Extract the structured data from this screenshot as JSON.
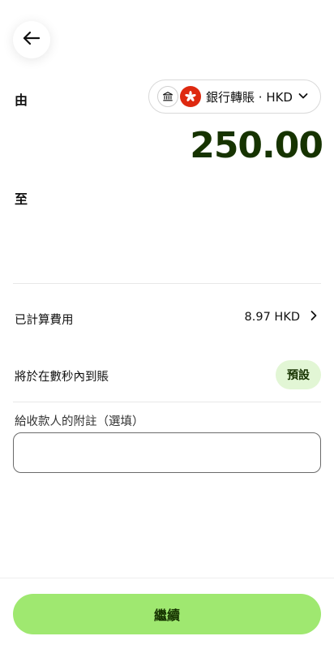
{
  "header": {
    "back_icon": "arrow-left-icon"
  },
  "from": {
    "label": "由",
    "source_text": "銀行轉賬 · HKD",
    "bank_icon": "bank-icon",
    "flag_icon": "hong-kong-flag-icon",
    "dropdown_icon": "chevron-down-icon"
  },
  "amount": "250.00",
  "to": {
    "label": "至"
  },
  "fees": {
    "label": "已計算費用",
    "value": "8.97 HKD",
    "icon": "chevron-right-icon"
  },
  "arrival": {
    "label": "將於在數秒內到賬",
    "badge": "預設"
  },
  "note": {
    "label": "給收款人的附註（選填）",
    "value": "",
    "placeholder": ""
  },
  "footer": {
    "continue_label": "繼續"
  },
  "colors": {
    "accent_green": "#9fe870",
    "dark_green": "#163300",
    "badge_bg": "#e2f6d5",
    "flag_red": "#de2910"
  }
}
